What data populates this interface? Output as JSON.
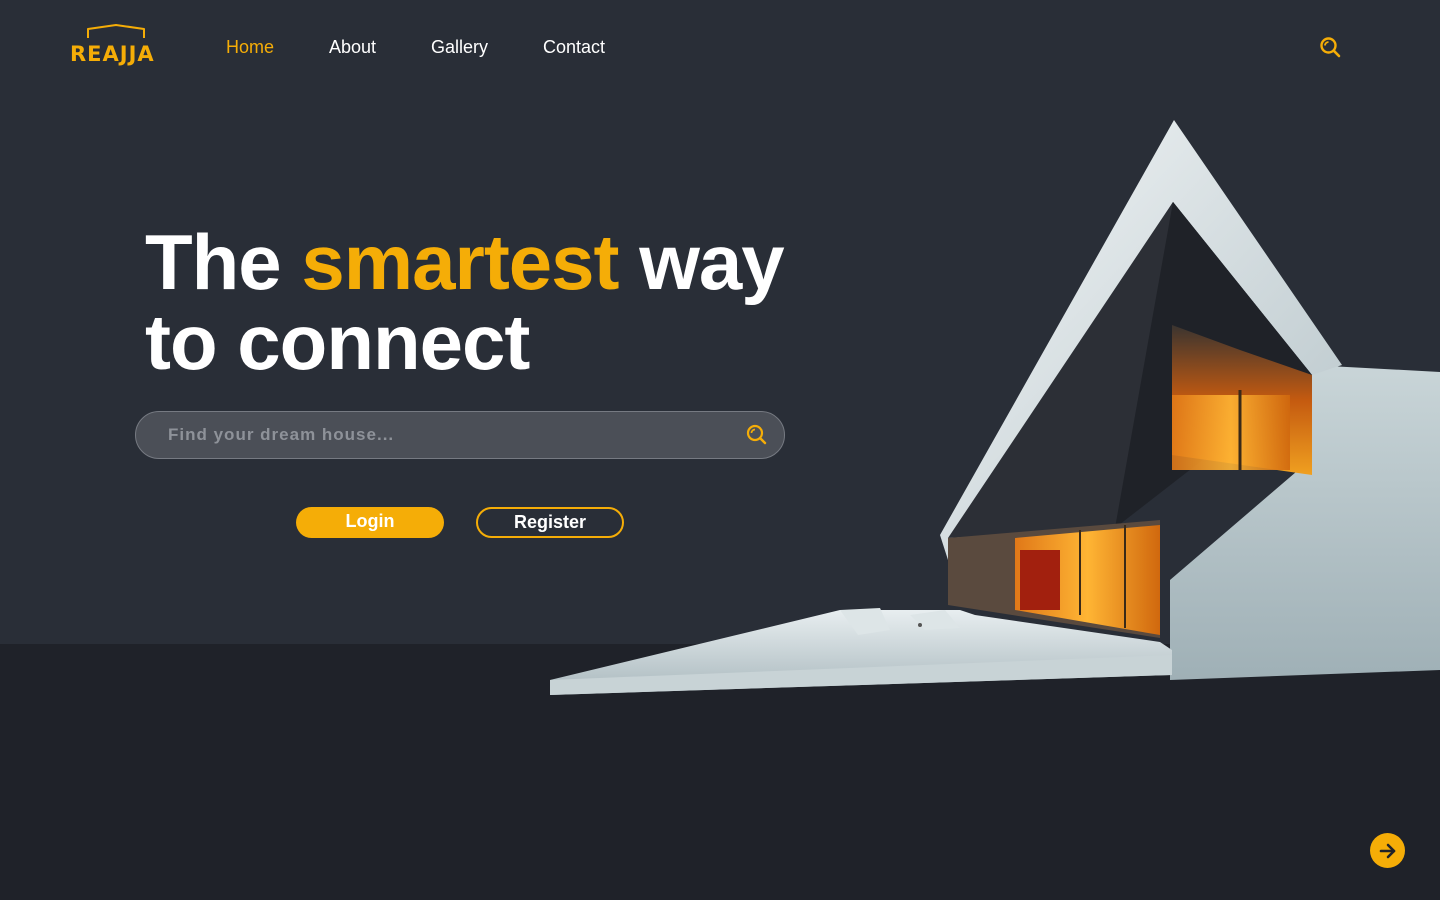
{
  "brand": {
    "logo_text": "REAJJA",
    "accent_color": "#f5ad07",
    "hero_bg_color": "#292e37",
    "bottom_bg_color": "#1f2229"
  },
  "nav": {
    "items": [
      {
        "label": "Home",
        "active": true
      },
      {
        "label": "About",
        "active": false
      },
      {
        "label": "Gallery",
        "active": false
      },
      {
        "label": "Contact",
        "active": false
      }
    ],
    "search_icon": "search-icon"
  },
  "hero": {
    "headline_part1": "The ",
    "headline_accent": "smartest",
    "headline_part2": " way",
    "headline_line2": "to connect",
    "search_placeholder": "Find your dream house...",
    "search_icon": "search-icon",
    "login_label": "Login",
    "register_label": "Register",
    "image": "modern-a-frame-house"
  },
  "footer": {
    "next_icon": "arrow-right-icon"
  }
}
